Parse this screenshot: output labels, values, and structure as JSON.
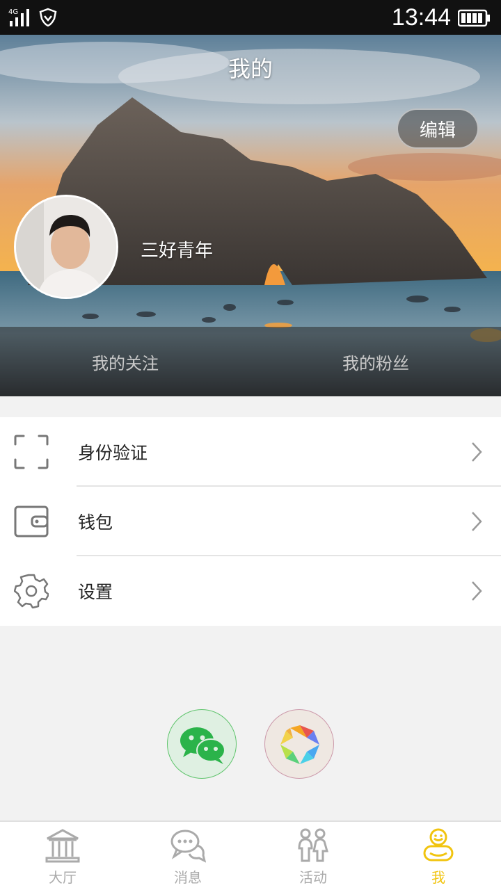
{
  "status_bar": {
    "network": "4G",
    "time": "13:44",
    "icons": [
      "signal-icon",
      "shield-icon",
      "battery-icon"
    ]
  },
  "header": {
    "title": "我的",
    "edit_label": "编辑"
  },
  "profile": {
    "username": "三好青年"
  },
  "hero_tabs": [
    {
      "label": "我的关注"
    },
    {
      "label": "我的粉丝"
    }
  ],
  "menu": {
    "items": [
      {
        "label": "身份验证",
        "icon": "scan-frame-icon"
      },
      {
        "label": "钱包",
        "icon": "wallet-icon"
      },
      {
        "label": "设置",
        "icon": "gear-icon"
      }
    ]
  },
  "share": {
    "items": [
      {
        "icon": "wechat-icon"
      },
      {
        "icon": "moments-icon"
      }
    ]
  },
  "tab_bar": {
    "items": [
      {
        "label": "大厅",
        "icon": "hall-icon",
        "active": false
      },
      {
        "label": "消息",
        "icon": "message-icon",
        "active": false
      },
      {
        "label": "活动",
        "icon": "activity-icon",
        "active": false
      },
      {
        "label": "我",
        "icon": "me-icon",
        "active": true
      }
    ],
    "active_color": "#f1c40f",
    "inactive_color": "#aaaaaa"
  }
}
